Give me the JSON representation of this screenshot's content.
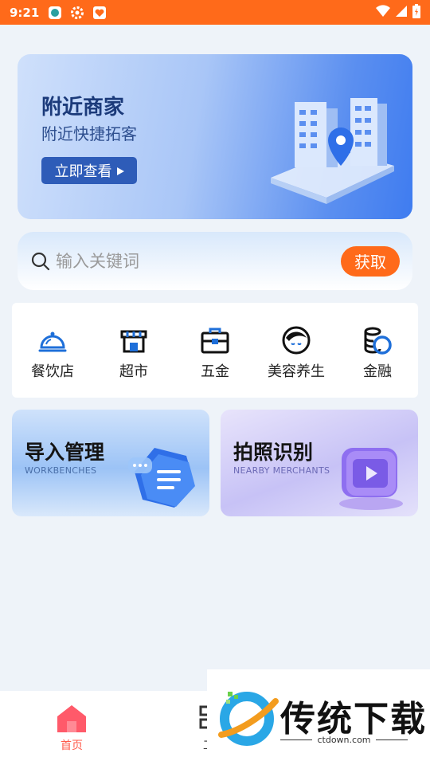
{
  "status_bar": {
    "time": "9:21"
  },
  "banner": {
    "title": "附近商家",
    "subtitle": "附近快捷拓客",
    "button_label": "立即查看"
  },
  "search": {
    "placeholder": "输入关键词",
    "button_label": "获取"
  },
  "categories": [
    {
      "label": "餐饮店",
      "icon": "dining-bell-icon"
    },
    {
      "label": "超市",
      "icon": "store-icon"
    },
    {
      "label": "五金",
      "icon": "toolbox-icon"
    },
    {
      "label": "美容养生",
      "icon": "beauty-face-icon"
    },
    {
      "label": "金融",
      "icon": "coins-icon"
    }
  ],
  "cards": {
    "left": {
      "title": "导入管理",
      "subtitle": "WORKBENCHES"
    },
    "right": {
      "title": "拍照识别",
      "subtitle": "NEARBY MERCHANTS"
    }
  },
  "bottom_nav": {
    "home_label": "首页",
    "work_label": "工"
  },
  "watermark": {
    "text": "传统下载",
    "url": "ctdown.com"
  },
  "colors": {
    "accent": "#ff6a1a",
    "banner_button": "#2e5cb8",
    "category_icon": "#1e6fd9",
    "home_active": "#ff5a4a"
  }
}
